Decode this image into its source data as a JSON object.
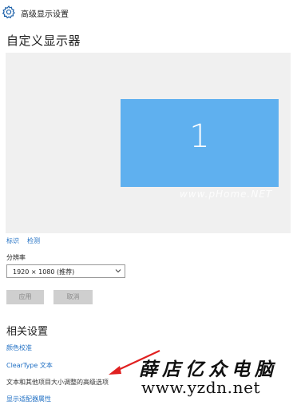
{
  "window": {
    "title": "高级显示设置"
  },
  "page_title": "自定义显示器",
  "preview": {
    "monitor_number": "1",
    "watermark": "www.pHome.NET",
    "accent": "#5fb0ef"
  },
  "actions": {
    "identify": "标识",
    "detect": "检测"
  },
  "resolution": {
    "label": "分辨率",
    "value": "1920 × 1080 (推荐)"
  },
  "buttons": {
    "apply": "应用",
    "cancel": "取消"
  },
  "related": {
    "heading": "相关设置",
    "items": [
      "颜色校准",
      "ClearType 文本",
      "文本和其他项目大小调整的高级选项",
      "显示适配器属性"
    ]
  },
  "overlay_watermark": {
    "brand": "薛店亿众电脑",
    "url": "www.yzdn.net"
  }
}
